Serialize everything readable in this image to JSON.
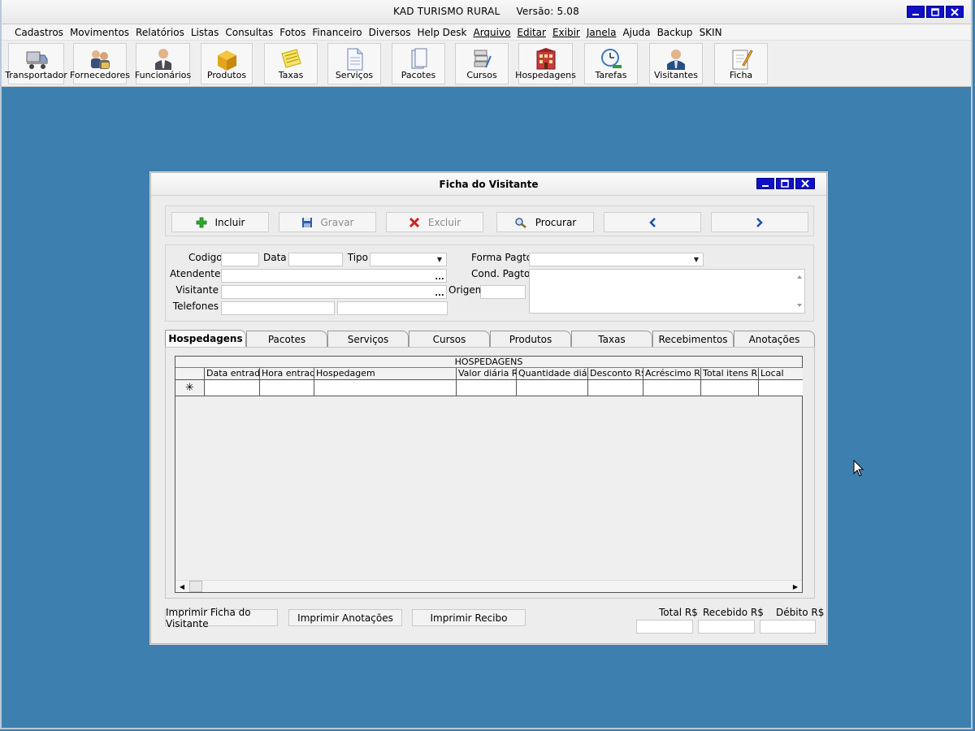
{
  "app": {
    "title": "KAD TURISMO RURAL",
    "version": "Versão: 5.08",
    "window_buttons": [
      "_",
      "□",
      "X"
    ]
  },
  "menu": [
    "Cadastros",
    "Movimentos",
    "Relatórios",
    "Listas",
    "Consultas",
    "Fotos",
    "Financeiro",
    "Diversos",
    "Help Desk",
    "Arquivo",
    "Editar",
    "Exibir",
    "Janela",
    "Ajuda",
    "Backup",
    "SKIN"
  ],
  "toolbar": [
    {
      "label": "Transportador",
      "icon": "truck-icon"
    },
    {
      "label": "Fornecedores",
      "icon": "suppliers-icon"
    },
    {
      "label": "Funcionários",
      "icon": "employee-icon"
    },
    {
      "label": "Produtos",
      "icon": "box-icon"
    },
    {
      "label": "Taxas",
      "icon": "notes-icon"
    },
    {
      "label": "Serviços",
      "icon": "document-icon"
    },
    {
      "label": "Pacotes",
      "icon": "package-icon"
    },
    {
      "label": "Cursos",
      "icon": "books-icon"
    },
    {
      "label": "Hospedagens",
      "icon": "hotel-icon"
    },
    {
      "label": "Tarefas",
      "icon": "clock-icon"
    },
    {
      "label": "Visitantes",
      "icon": "visitor-icon"
    },
    {
      "label": "Ficha",
      "icon": "form-pencil-icon"
    }
  ],
  "form": {
    "title": "Ficha do Visitante",
    "actions": {
      "incluir": "Incluir",
      "gravar": "Gravar",
      "excluir": "Excluir",
      "procurar": "Procurar"
    },
    "fields": {
      "codigo": "Codigo",
      "data": "Data",
      "tipo": "Tipo",
      "forma_pagto": "Forma Pagto",
      "atendente": "Atendente",
      "cond_pagto": "Cond. Pagto",
      "visitante": "Visitante",
      "origem": "Origem",
      "telefones": "Telefones"
    },
    "values": {
      "codigo": "",
      "data": "",
      "tipo": "",
      "forma_pagto": "",
      "atendente": "",
      "visitante": "",
      "origem": "",
      "telefone1": "",
      "telefone2": "",
      "cond_pagto": ""
    },
    "tabs": [
      "Hospedagens",
      "Pacotes",
      "Serviços",
      "Cursos",
      "Produtos",
      "Taxas",
      "Recebimentos",
      "Anotações"
    ],
    "active_tab": "Hospedagens",
    "grid": {
      "caption": "HOSPEDAGENS",
      "columns": [
        "Data entrada",
        "Hora entrada",
        "Hospedagem",
        "Valor diária R$",
        "Quantidade diária",
        "Desconto R$",
        "Acréscimo R$",
        "Total itens R$",
        "Local"
      ],
      "new_row_marker": "✳"
    },
    "bottom_buttons": {
      "imprimir_ficha": "Imprimir Ficha do Visitante",
      "imprimir_anotacoes": "Imprimir Anotações",
      "imprimir_recibo": "Imprimir Recibo"
    },
    "totals": {
      "total_label": "Total R$",
      "recebido_label": "Recebido R$",
      "debito_label": "Débito R$",
      "total": "",
      "recebido": "",
      "debito": ""
    }
  },
  "colors": {
    "desktop": "#3d7fae",
    "window_button": "#1010c8",
    "incluir_icon": "#2ea82e",
    "excluir_icon": "#d42020",
    "nav_arrow": "#1a4fb0"
  }
}
